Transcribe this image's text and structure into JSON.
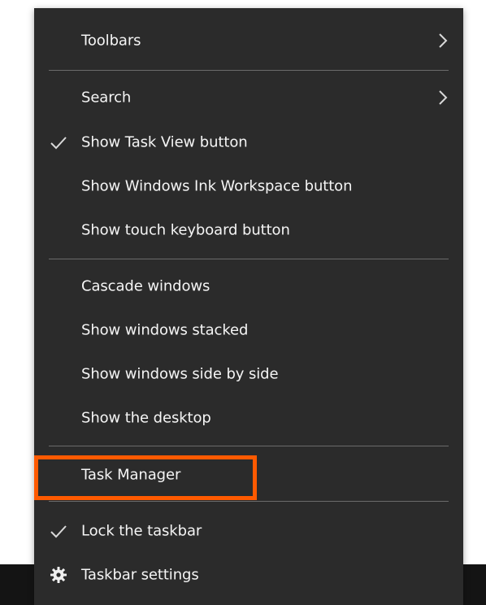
{
  "menu": {
    "groups": [
      [
        {
          "label": "Toolbars",
          "submenu": true
        }
      ],
      [
        {
          "label": "Search",
          "submenu": true
        },
        {
          "label": "Show Task View button",
          "checked": true
        },
        {
          "label": "Show Windows Ink Workspace button"
        },
        {
          "label": "Show touch keyboard button"
        }
      ],
      [
        {
          "label": "Cascade windows"
        },
        {
          "label": "Show windows stacked"
        },
        {
          "label": "Show windows side by side"
        },
        {
          "label": "Show the desktop"
        }
      ],
      [
        {
          "label": "Task Manager",
          "highlighted": true
        }
      ],
      [
        {
          "label": "Lock the taskbar",
          "checked": true
        },
        {
          "label": "Taskbar settings",
          "icon": "gear-icon"
        }
      ]
    ]
  },
  "colors": {
    "menu_bg": "#2b2b2b",
    "text": "#f5f5f5",
    "separator": "#6b6b6b",
    "highlight_border": "#ff5a00",
    "taskbar": "#141414"
  }
}
